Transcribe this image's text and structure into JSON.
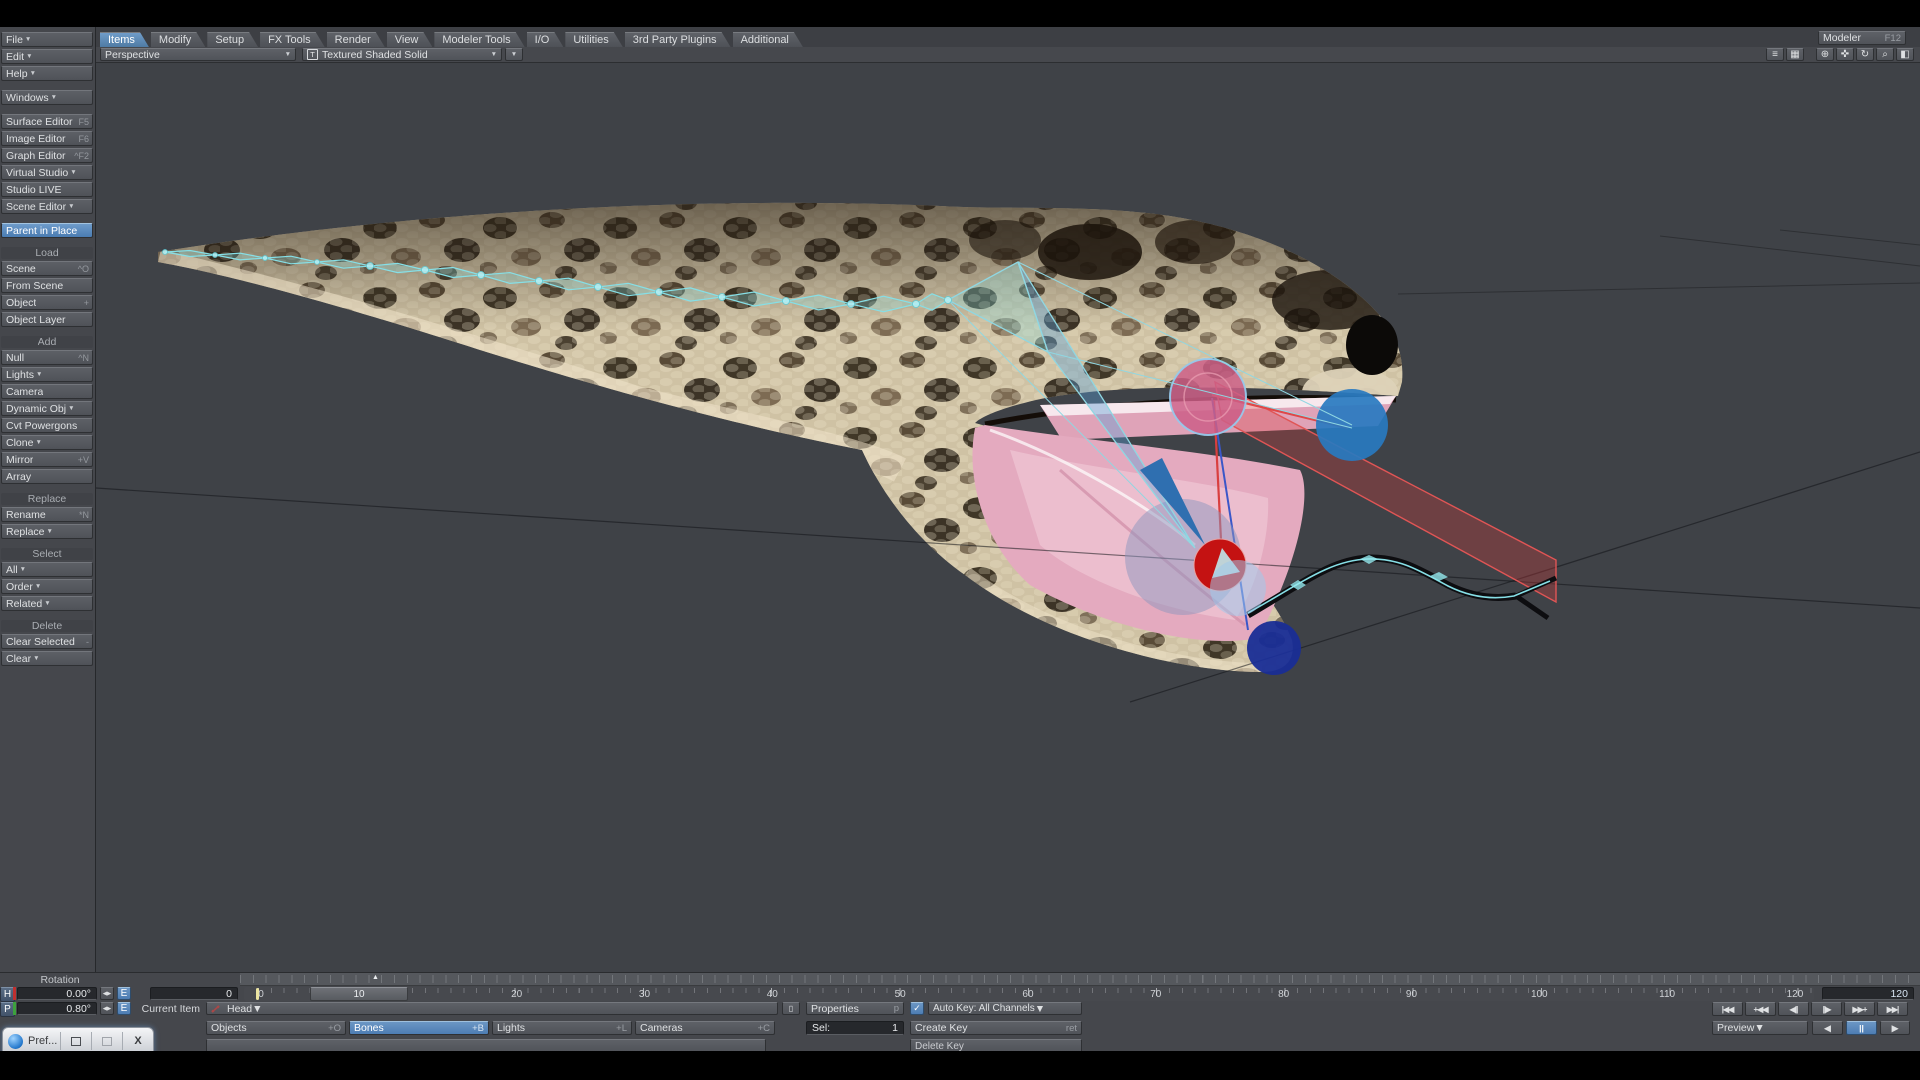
{
  "colors": {
    "accent_blue": "#4d7db3",
    "selected_tab_blue": "#4f7ba4",
    "bone_cyan": "#86dfe6",
    "mouth_pink": "#e2a9bd",
    "key_marker_yellow": "#ece5a2",
    "viewport_background": "#3f4247"
  },
  "topbar": {
    "tabs": [
      {
        "label": "Items",
        "cls": "selected"
      },
      {
        "label": "Modify"
      },
      {
        "label": "Setup"
      },
      {
        "label": "FX Tools"
      },
      {
        "label": "Render"
      },
      {
        "label": "View"
      },
      {
        "label": "Modeler Tools"
      },
      {
        "label": "I/O"
      },
      {
        "label": "Utilities"
      },
      {
        "label": "3rd Party Plugins"
      },
      {
        "label": "Additional"
      }
    ],
    "modeler": {
      "label": "Modeler",
      "shortcut": "F12"
    }
  },
  "sidebar": {
    "items": [
      {
        "cls": "sb-item",
        "label": "File",
        "arrow": "▼"
      },
      {
        "cls": "sb-item",
        "label": "Edit",
        "arrow": "▼"
      },
      {
        "cls": "sb-item",
        "label": "Help",
        "arrow": "▼"
      },
      {
        "cls": "sb-gap"
      },
      {
        "cls": "sb-item",
        "label": "Windows",
        "arrow": "▼"
      },
      {
        "cls": "sb-gap"
      },
      {
        "cls": "sb-item",
        "label": "Surface Editor",
        "shortcut": "F5"
      },
      {
        "cls": "sb-item",
        "label": "Image Editor",
        "shortcut": "F6"
      },
      {
        "cls": "sb-item",
        "label": "Graph Editor",
        "shortcut": "^F2"
      },
      {
        "cls": "sb-item",
        "label": "Virtual Studio",
        "arrow": "▼"
      },
      {
        "cls": "sb-item",
        "label": "Studio LIVE"
      },
      {
        "cls": "sb-item",
        "label": "Scene Editor",
        "arrow": "▼"
      },
      {
        "cls": "sb-gap"
      },
      {
        "cls": "sb-item selected",
        "label": "Parent in Place"
      },
      {
        "cls": "sb-gap"
      },
      {
        "cls": "sb-header",
        "label": "Load"
      },
      {
        "cls": "sb-item",
        "label": "Scene",
        "shortcut": "^O"
      },
      {
        "cls": "sb-item",
        "label": "From Scene"
      },
      {
        "cls": "sb-item",
        "label": "Object",
        "shortcut": "+"
      },
      {
        "cls": "sb-item",
        "label": "Object Layer"
      },
      {
        "cls": "sb-gap"
      },
      {
        "cls": "sb-header",
        "label": "Add"
      },
      {
        "cls": "sb-item",
        "label": "Null",
        "shortcut": "^N"
      },
      {
        "cls": "sb-item",
        "label": "Lights",
        "arrow": "▼"
      },
      {
        "cls": "sb-item",
        "label": "Camera"
      },
      {
        "cls": "sb-item",
        "label": "Dynamic Obj",
        "arrow": "▼"
      },
      {
        "cls": "sb-item",
        "label": "Cvt Powergons"
      },
      {
        "cls": "sb-item",
        "label": "Clone",
        "arrow": "▼"
      },
      {
        "cls": "sb-item",
        "label": "Mirror",
        "shortcut": "+V"
      },
      {
        "cls": "sb-item",
        "label": "Array"
      },
      {
        "cls": "sb-gap"
      },
      {
        "cls": "sb-header",
        "label": "Replace"
      },
      {
        "cls": "sb-item",
        "label": "Rename",
        "shortcut": "*N"
      },
      {
        "cls": "sb-item",
        "label": "Replace",
        "arrow": "▼"
      },
      {
        "cls": "sb-gap"
      },
      {
        "cls": "sb-header",
        "label": "Select"
      },
      {
        "cls": "sb-item",
        "label": "All",
        "arrow": "▼"
      },
      {
        "cls": "sb-item",
        "label": "Order",
        "arrow": "▼"
      },
      {
        "cls": "sb-item",
        "label": "Related",
        "arrow": "▼"
      },
      {
        "cls": "sb-gap"
      },
      {
        "cls": "sb-header",
        "label": "Delete"
      },
      {
        "cls": "sb-item",
        "label": "Clear Selected",
        "shortcut": "-"
      },
      {
        "cls": "sb-item",
        "label": "Clear",
        "arrow": "▼"
      }
    ]
  },
  "viewport_bar": {
    "view_mode": "Perspective",
    "shading_icon": "T",
    "shading_mode": "Textured Shaded Solid",
    "arrow": "▼",
    "icons": [
      {
        "glyph": "≡"
      },
      {
        "glyph": "▦"
      },
      {
        "glyph": "⊕"
      },
      {
        "glyph": "✜"
      },
      {
        "glyph": "↻"
      },
      {
        "glyph": "⌕"
      },
      {
        "glyph": "◧"
      }
    ]
  },
  "rotation": {
    "title": "Rotation",
    "h_label": "H",
    "h_value": "0.00°",
    "p_label": "P",
    "p_value": "0.80°",
    "edit_label": "E",
    "stepper": "◀▶"
  },
  "timeline": {
    "start_frame": "0",
    "end_frame": "120",
    "slider_frame": "10",
    "labels": [
      {
        "t": "0"
      },
      {
        "t": "10"
      },
      {
        "t": "20"
      },
      {
        "t": "30"
      },
      {
        "t": "40"
      },
      {
        "t": "50"
      },
      {
        "t": "60"
      },
      {
        "t": "70"
      },
      {
        "t": "80"
      },
      {
        "t": "90"
      },
      {
        "t": "100"
      },
      {
        "t": "110"
      },
      {
        "t": "120"
      }
    ]
  },
  "items_bar": {
    "current_item_label": "Current Item",
    "current_item": "Head",
    "dd_arrow": "▼",
    "picker_glyph": "▯",
    "types": [
      {
        "label": "Objects",
        "shortcut": "+O"
      },
      {
        "label": "Bones",
        "shortcut": "+B",
        "cls": "selected"
      },
      {
        "label": "Lights",
        "shortcut": "+L"
      },
      {
        "label": "Cameras",
        "shortcut": "+C"
      }
    ],
    "properties_label": "Properties",
    "properties_shortcut": "p",
    "sel_label": "Sel:",
    "sel_value": "1",
    "auto_key_check": "✓",
    "auto_key_label": "Auto Key: All Channels",
    "create_key_label": "Create Key",
    "create_key_shortcut": "ret",
    "partial_row_right": "Delete Key",
    "partial_row_left": ""
  },
  "transport": {
    "go_start": "|◀◀",
    "prev_key": "+◀◀",
    "step_back": "◀||",
    "step_fwd": "||▶",
    "next_key": "▶▶+",
    "go_end": "▶▶|"
  },
  "preview": {
    "label": "Preview",
    "arrow": "▼",
    "back": "◀",
    "pause": "||",
    "play": "▶"
  },
  "pref_window": {
    "title": "Pref..."
  }
}
